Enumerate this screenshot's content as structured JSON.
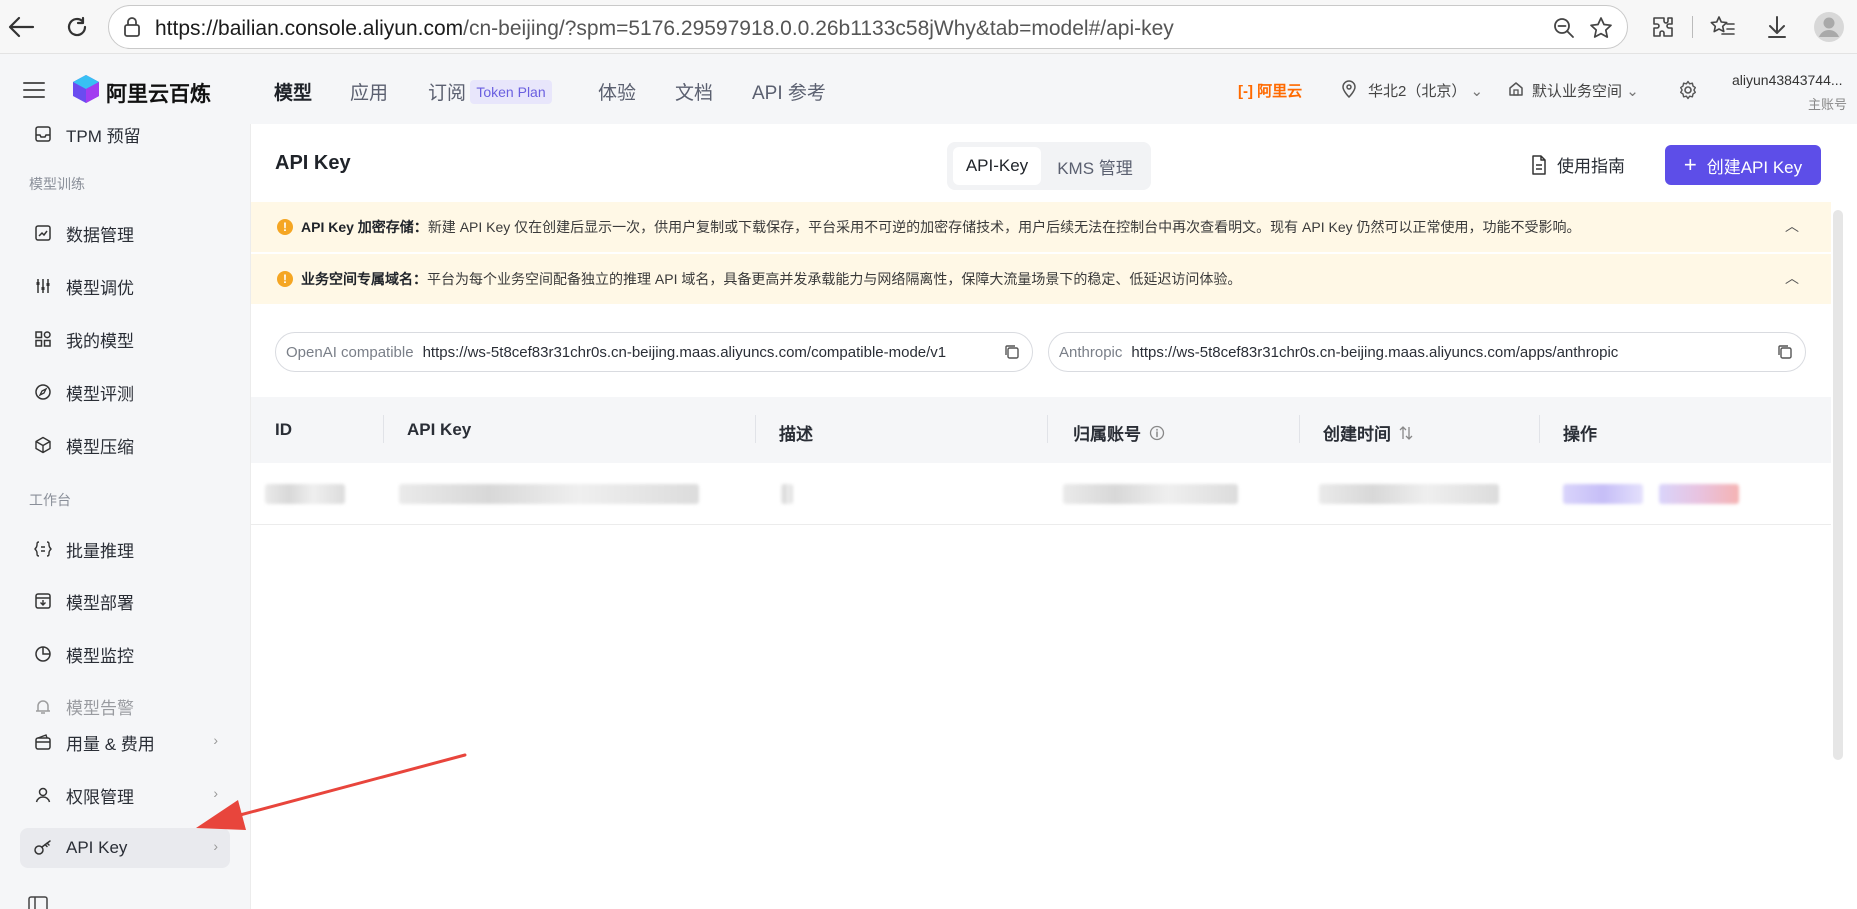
{
  "browser": {
    "url_host": "https://bailian.console.aliyun.com",
    "url_rest": "/cn-beijing/?spm=5176.29597918.0.0.26b1133c58jWhy&tab=model#/api-key"
  },
  "header": {
    "logo": "阿里云百炼",
    "nav": [
      "模型",
      "应用",
      "订阅",
      "体验",
      "文档",
      "API 参考"
    ],
    "token_badge": "Token Plan",
    "aliyun": "阿里云",
    "region": "华北2（北京）",
    "workspace": "默认业务空间",
    "account": "aliyun43843744...",
    "account_role": "主账号"
  },
  "sidebar": {
    "top_item": "TPM 预留",
    "section_training": "模型训练",
    "training_items": [
      "数据管理",
      "模型调优",
      "我的模型",
      "模型评测",
      "模型压缩"
    ],
    "section_workbench": "工作台",
    "workbench_items": [
      "批量推理",
      "模型部署",
      "模型监控",
      "模型告警"
    ],
    "bottom_items": [
      "用量 & 费用",
      "权限管理",
      "API Key"
    ]
  },
  "main": {
    "title": "API Key",
    "tabs": [
      "API-Key",
      "KMS 管理"
    ],
    "guide": "使用指南",
    "create_button": "创建API Key",
    "notice1_title": "API Key 加密存储：",
    "notice1_text": "新建 API Key 仅在创建后显示一次，供用户复制或下载保存，平台采用不可逆的加密存储技术，用户后续无法在控制台中再次查看明文。现有 API Key 仍然可以正常使用，功能不受影响。",
    "notice2_title": "业务空间专属域名：",
    "notice2_text": "平台为每个业务空间配备独立的推理 API 域名，具备更高并发承载能力与网络隔离性，保障大流量场景下的稳定、低延迟访问体验。",
    "endpoint_openai_label": "OpenAI compatible",
    "endpoint_openai_url": "https://ws-5t8cef83r31chr0s.cn-beijing.maas.aliyuncs.com/compatible-mode/v1",
    "endpoint_anthropic_label": "Anthropic",
    "endpoint_anthropic_url": "https://ws-5t8cef83r31chr0s.cn-beijing.maas.aliyuncs.com/apps/anthropic",
    "columns": [
      "ID",
      "API Key",
      "描述",
      "归属账号",
      "创建时间",
      "操作"
    ]
  },
  "colors": {
    "brand": "#5d4ee8",
    "warning": "#f5a623",
    "annotation_arrow": "#e8453c"
  }
}
